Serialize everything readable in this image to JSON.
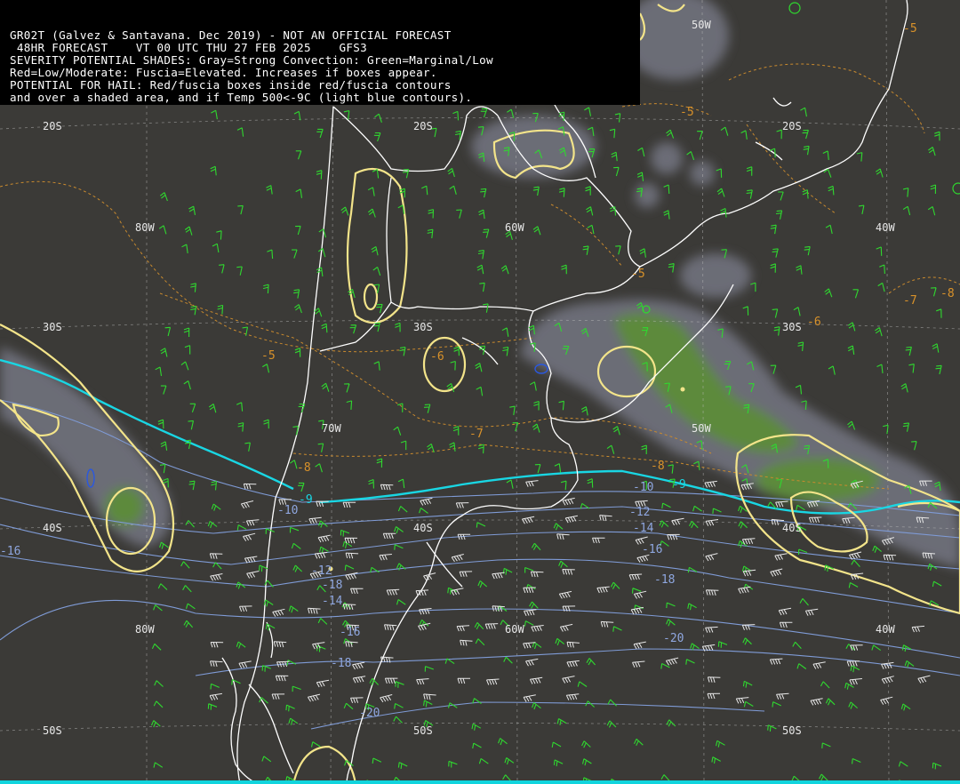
{
  "header": {
    "line1": "GR02T (Galvez & Santavana. Dec 2019) - NOT AN OFFICIAL FORECAST",
    "line2": " 48HR FORECAST    VT 00 UTC THU 27 FEB 2025    GFS3",
    "line3": "SEVERITY POTENTIAL SHADES: Gray=Strong Convection: Green=Marginal/Low",
    "line4": "Red=Low/Moderate: Fuscia=Elevated. Increases if boxes appear.",
    "line5": "POTENTIAL FOR HAIL: Red/fuscia boxes inside red/fuscia contours",
    "line6": "and over a shaded area, and if Temp 500<-9C (light blue contours)."
  },
  "grid_labels": {
    "lat_20s_west": "20S",
    "lat_20s_mid": "20S",
    "lat_20s_east": "20S",
    "lon_80w_north": "80W",
    "lon_60w_north": "60W",
    "lon_40w_north": "40W",
    "lon_50w_top": "50W",
    "lat_30s_west": "30S",
    "lat_30s_mid": "30S",
    "lat_30s_east": "30S",
    "lon_70w": "70W",
    "lon_50w": "50W",
    "lat_40s_west": "40S",
    "lat_40s_mid": "40S",
    "lat_40s_east": "40S",
    "lon_80w_south": "80W",
    "lon_60w_south": "60W",
    "lon_40w_south": "40W",
    "lat_50s_west": "50S",
    "lat_50s_mid": "50S",
    "lat_50s_east": "50S"
  },
  "temp_labels": {
    "t1": "-5",
    "t2": "-5",
    "t3": "-5",
    "t4": "-5",
    "t5": "-6",
    "t6": "-6",
    "t7": "-7",
    "t8": "-7",
    "t9": "-8",
    "t10": "-8",
    "t11": "-8",
    "t12": "-9",
    "t13": "-9",
    "b1": "-10",
    "b2": "-10",
    "b3": "-12",
    "b4": "-12",
    "b5": "-14",
    "b6": "-14",
    "b7": "-16",
    "b8": "-16",
    "b9": "-16",
    "b10": "-18",
    "b11": "-18",
    "b12": "-18",
    "b13": "-20",
    "b14": "-20"
  },
  "colors": {
    "background": "#3b3a37",
    "shade_gray": "#6e6f7a",
    "shade_green": "#5f8f3c",
    "severity_contour": "#f3e48a",
    "temp_9c_contour": "#19d6e3",
    "temp_cold_contour": "#7f9bd6",
    "temp_warm_contour": "#c98a2e",
    "coastline": "#ffffff",
    "wind_barb": "#2fd82f"
  }
}
